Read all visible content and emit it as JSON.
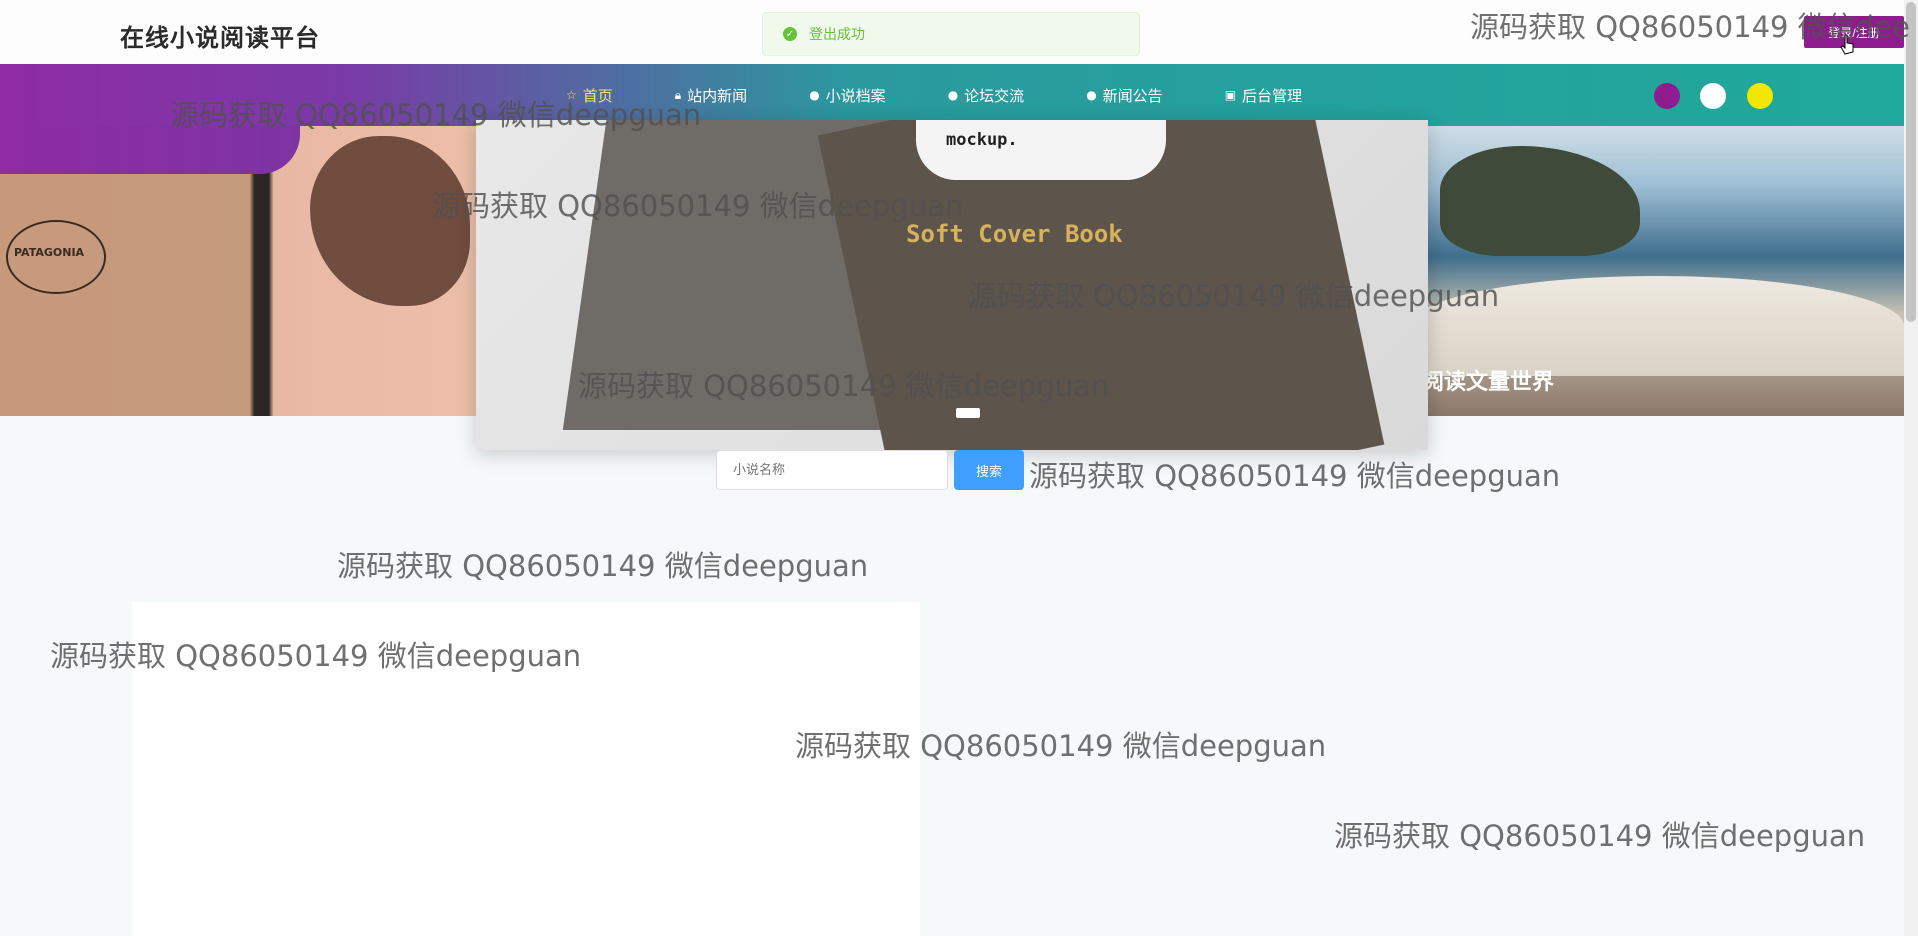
{
  "header": {
    "site_title": "在线小说阅读平台",
    "login_label": "登录/注册"
  },
  "toast": {
    "message": "登出成功",
    "status_color": "#67c23a"
  },
  "nav": {
    "items": [
      {
        "label": "首页",
        "icon": "star-icon",
        "active": true
      },
      {
        "label": "站内新闻",
        "icon": "lock-icon",
        "active": false
      },
      {
        "label": "小说档案",
        "icon": "info-icon",
        "active": false
      },
      {
        "label": "论坛交流",
        "icon": "info-icon",
        "active": false
      },
      {
        "label": "新闻公告",
        "icon": "info-icon",
        "active": false
      },
      {
        "label": "后台管理",
        "icon": "bag-icon",
        "active": false
      }
    ],
    "theme_dots": [
      "#8e1c8e",
      "#ffffff",
      "#f1e600"
    ]
  },
  "banner": {
    "left_caption": "PATAGONIA",
    "center_brand": "mockup.",
    "center_title": "Soft Cover Book",
    "right_caption": "阅读文量世界"
  },
  "search": {
    "placeholder": "小说名称",
    "button_label": "搜索"
  },
  "watermark": "源码获取 QQ86050149 微信deepguan",
  "watermark_cut": "源码获取 QQ86050149 微信dee"
}
